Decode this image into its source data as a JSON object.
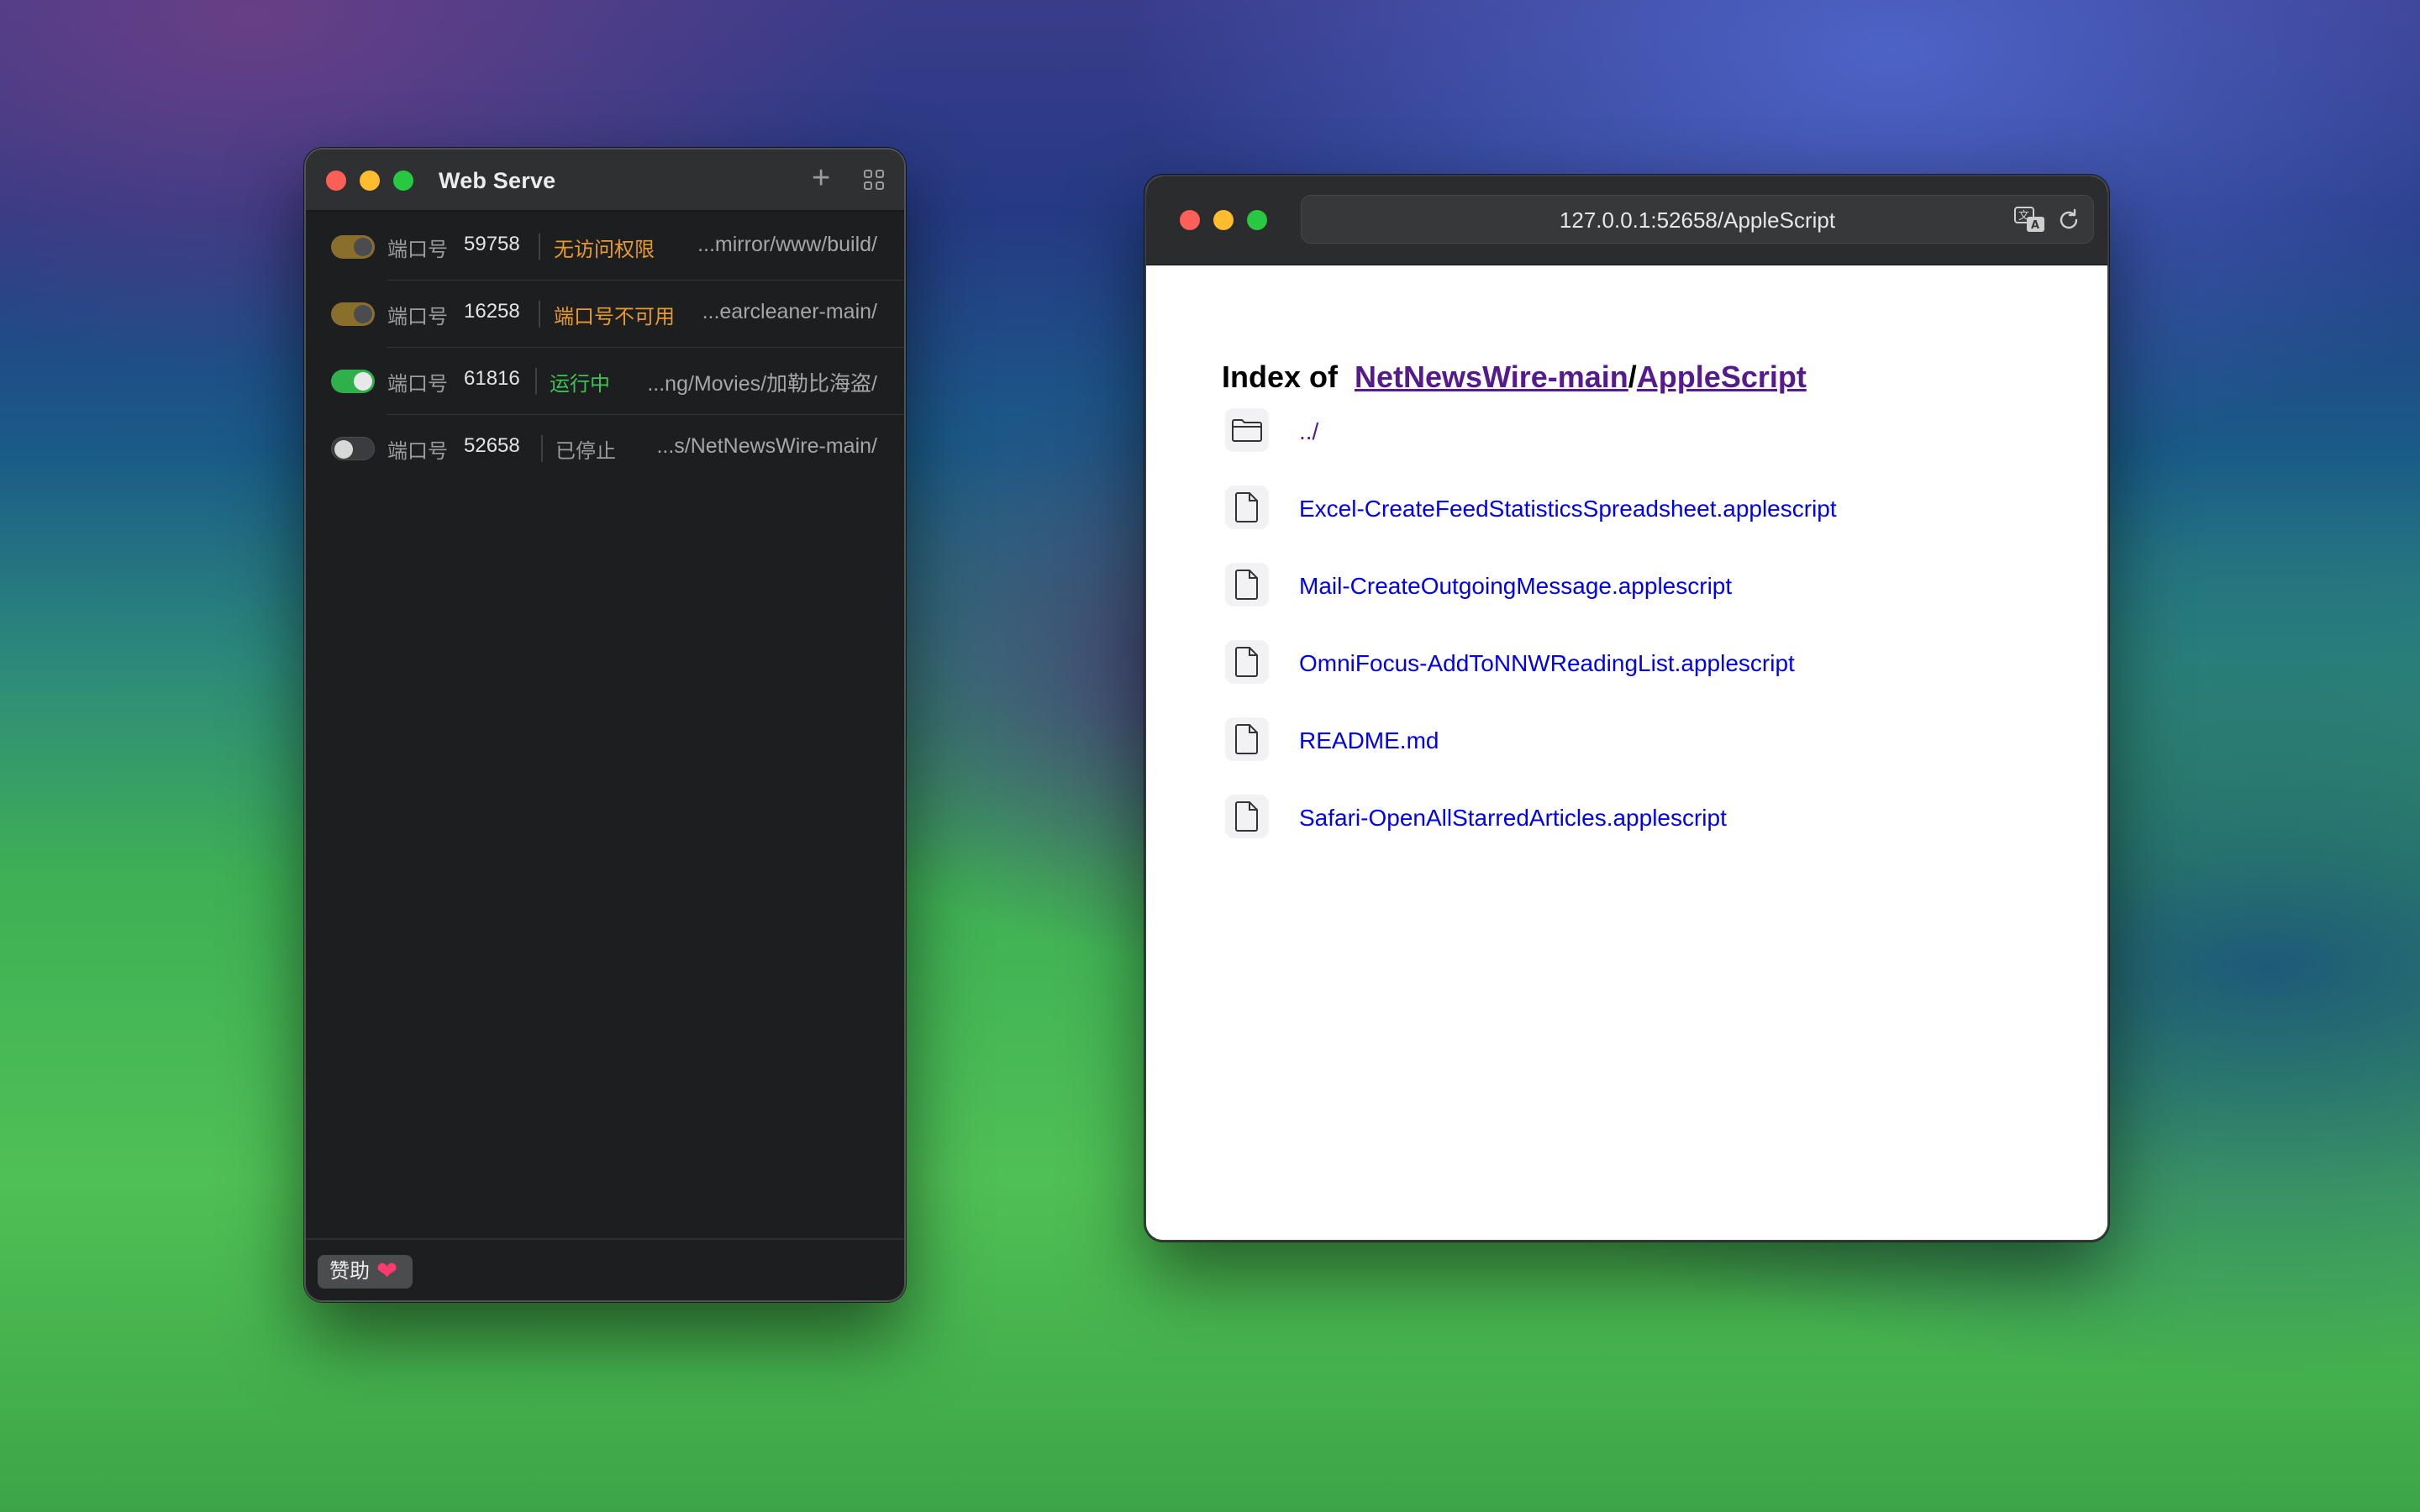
{
  "web_serve": {
    "title": "Web Serve",
    "add_label": "+",
    "rows": [
      {
        "port_label": "端口号",
        "port": "59758",
        "status": "无访问权限",
        "path": "...mirror/www/build/"
      },
      {
        "port_label": "端口号",
        "port": "16258",
        "status": "端口号不可用",
        "path": "...earcleaner-main/"
      },
      {
        "port_label": "端口号",
        "port": "61816",
        "status": "运行中",
        "path": "...ng/Movies/加勒比海盗/"
      },
      {
        "port_label": "端口号",
        "port": "52658",
        "status": "已停止",
        "path": "...s/NetNewsWire-main/"
      }
    ],
    "donate_label": "赞助",
    "heart": "❤"
  },
  "browser": {
    "url": "127.0.0.1:52658/AppleScript",
    "heading_prefix": "Index of",
    "crumb_1": "NetNewsWire-main",
    "crumb_sep": "/",
    "crumb_2": "AppleScript",
    "entries": [
      {
        "name": "../",
        "icon": "folder-icon"
      },
      {
        "name": "Excel-CreateFeedStatisticsSpreadsheet.applescript",
        "icon": "file-icon"
      },
      {
        "name": "Mail-CreateOutgoingMessage.applescript",
        "icon": "file-icon"
      },
      {
        "name": "OmniFocus-AddToNNWReadingList.applescript",
        "icon": "file-icon"
      },
      {
        "name": "README.md",
        "icon": "file-icon"
      },
      {
        "name": "Safari-OpenAllStarredArticles.applescript",
        "icon": "file-icon"
      }
    ]
  },
  "colors": {
    "warning": "#e89a2f",
    "running": "#3bc455",
    "stopped": "#9a9c9e",
    "link": "#0000ee",
    "visited": "#551a8b"
  }
}
